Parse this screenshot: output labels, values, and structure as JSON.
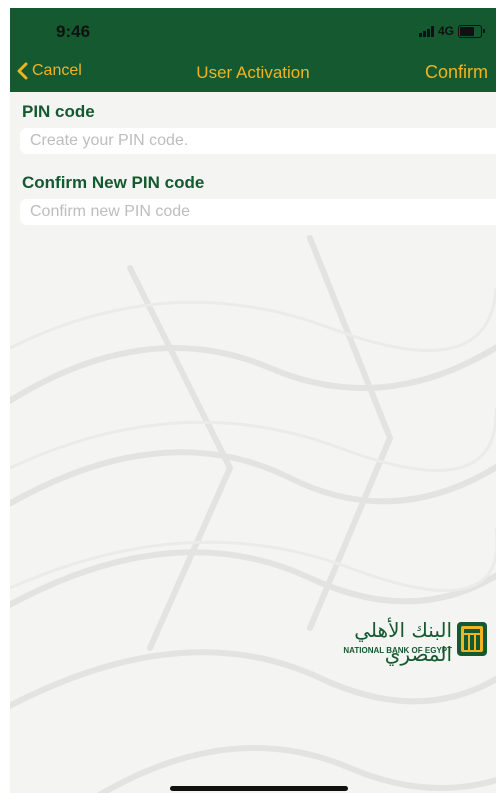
{
  "status_bar": {
    "time": "9:46",
    "network": "4G"
  },
  "nav": {
    "back_label": "Cancel",
    "title": "User Activation",
    "confirm_label": "Confirm"
  },
  "form": {
    "pin": {
      "label": "PIN code",
      "value": "",
      "placeholder": "Create your PIN code."
    },
    "confirm_pin": {
      "label": "Confirm New PIN code",
      "value": "",
      "placeholder": "Confirm new PIN code"
    }
  },
  "logo": {
    "arabic_text": "البنك الأهلي المصري",
    "english_text": "NATIONAL BANK OF EGYPT"
  },
  "colors": {
    "brand_green": "#14592f",
    "accent_gold": "#f0b423"
  },
  "icons": {
    "back": "chevron-left-icon",
    "signal": "signal-icon",
    "battery": "battery-icon",
    "logo_mark": "nbe-logo-icon"
  }
}
